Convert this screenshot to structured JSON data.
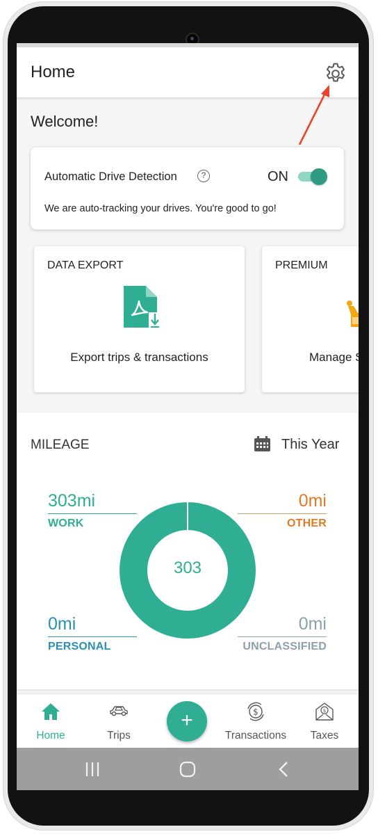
{
  "app_bar": {
    "title": "Home",
    "settings_icon": "gear-icon"
  },
  "welcome": "Welcome!",
  "drive_detection": {
    "title": "Automatic Drive Detection",
    "help_icon": "question-circle-icon",
    "toggle_label": "ON",
    "toggle_on": true,
    "subtitle": "We are auto-tracking your drives. You're good to go!"
  },
  "tiles": [
    {
      "title": "DATA EXPORT",
      "icon": "pdf-download-icon",
      "caption": "Export trips & transactions"
    },
    {
      "title": "PREMIUM",
      "icon": "premium-icon",
      "caption": "Manage S"
    }
  ],
  "mileage": {
    "title": "MILEAGE",
    "calendar_icon": "calendar-icon",
    "range": "This Year",
    "total": "303",
    "stats": {
      "work": {
        "value": "303mi",
        "label": "WORK",
        "color": "#2fae93"
      },
      "other": {
        "value": "0mi",
        "label": "OTHER",
        "color": "#e07b25"
      },
      "personal": {
        "value": "0mi",
        "label": "PERSONAL",
        "color": "#2b8fb5"
      },
      "unclassified": {
        "value": "0mi",
        "label": "UNCLASSIFIED",
        "color": "#8aa0ab"
      }
    }
  },
  "bottom_nav": {
    "items": [
      {
        "label": "Home",
        "icon": "home-icon",
        "active": true
      },
      {
        "label": "Trips",
        "icon": "car-icon",
        "active": false
      },
      {
        "label": "Transactions",
        "icon": "dollar-cycle-icon",
        "active": false
      },
      {
        "label": "Taxes",
        "icon": "tax-envelope-icon",
        "active": false
      }
    ],
    "fab_label": "+"
  },
  "colors": {
    "accent": "#2fae93",
    "annotation_arrow": "#e8432b"
  }
}
